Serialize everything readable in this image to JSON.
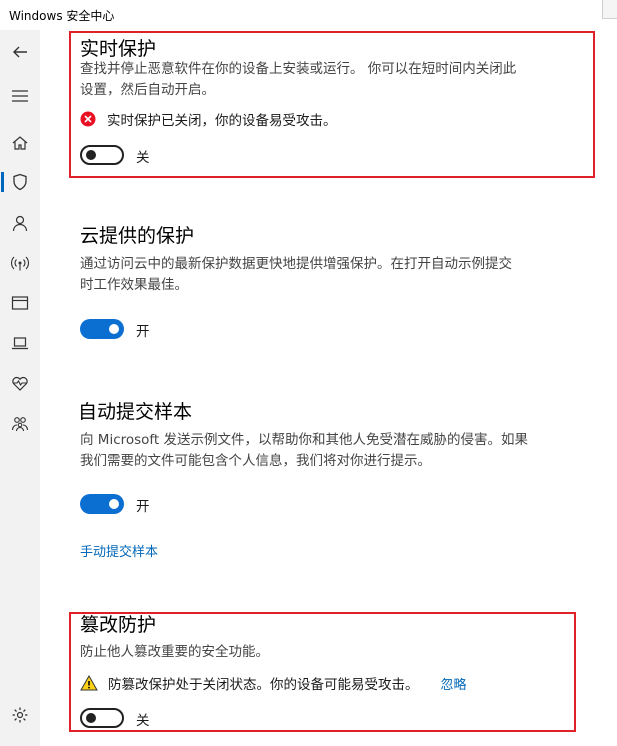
{
  "window": {
    "title": "Windows 安全中心"
  },
  "sidebar": {
    "items": [
      {
        "name": "back-icon"
      },
      {
        "name": "menu-icon"
      },
      {
        "name": "home-icon"
      },
      {
        "name": "shield-icon"
      },
      {
        "name": "account-icon"
      },
      {
        "name": "wifi-icon"
      },
      {
        "name": "app-browser-icon"
      },
      {
        "name": "device-icon"
      },
      {
        "name": "health-icon"
      },
      {
        "name": "family-icon"
      },
      {
        "name": "settings-icon"
      }
    ]
  },
  "realtime": {
    "title": "实时保护",
    "desc_line1": "查找并停止恶意软件在你的设备上安装或运行。 你可以在短时间内关闭此",
    "desc_line2": "设置，然后自动开启。",
    "alert": "实时保护已关闭，你的设备易受攻击。",
    "toggle_label": "关",
    "toggle_on": false
  },
  "cloud": {
    "title": "云提供的保护",
    "desc_line1": "通过访问云中的最新保护数据更快地提供增强保护。在打开自动示例提交",
    "desc_line2": "时工作效果最佳。",
    "toggle_label": "开",
    "toggle_on": true
  },
  "sample": {
    "title": "自动提交样本",
    "desc_line1": "向 Microsoft 发送示例文件，以帮助你和其他人免受潜在威胁的侵害。如果",
    "desc_line2": "我们需要的文件可能包含个人信息，我们将对你进行提示。",
    "toggle_label": "开",
    "toggle_on": true,
    "link": "手动提交样本"
  },
  "tamper": {
    "title": "篡改防护",
    "desc": "防止他人篡改重要的安全功能。",
    "alert": "防篡改保护处于关闭状态。你的设备可能易受攻击。",
    "ignore": "忽略",
    "toggle_label": "关",
    "toggle_on": false
  },
  "colors": {
    "accent": "#0067b8",
    "toggle_on": "#0b6fd2",
    "error": "#e81123",
    "warning": "#fcd116",
    "highlight_box": "#e0212a"
  }
}
